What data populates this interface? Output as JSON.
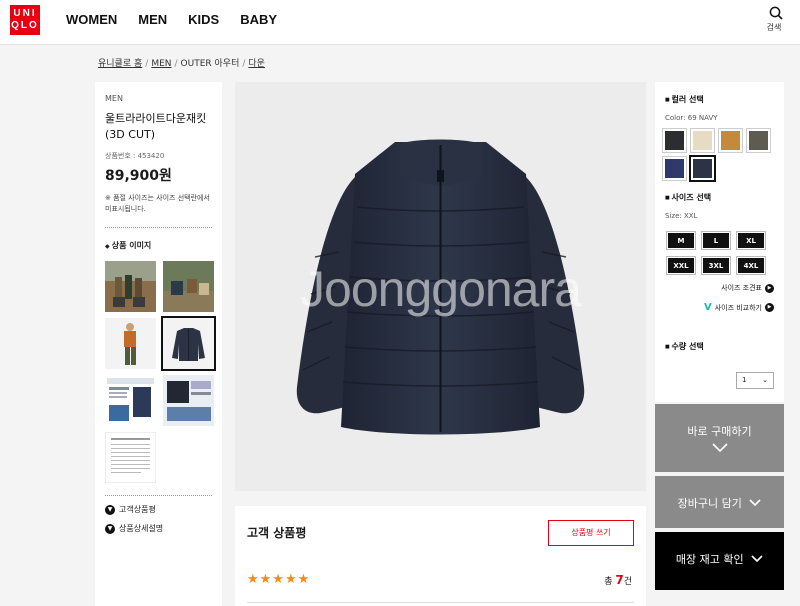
{
  "header": {
    "logo_line1": "UNI",
    "logo_line2": "QLO",
    "nav": [
      "WOMEN",
      "MEN",
      "KIDS",
      "BABY"
    ],
    "search_label": "검색"
  },
  "breadcrumb": {
    "home": "유니클로 홈",
    "men": "MEN",
    "outer": "OUTER 아우터",
    "current": "다운"
  },
  "product": {
    "category": "MEN",
    "name": "울트라라이트다운재킷(3D CUT)",
    "number": "상품번호 : 453420",
    "price": "89,900원",
    "size_note": "※ 품절 사이즈는 사이즈 선택란에서 미표시됩니다."
  },
  "images": {
    "section_title": "상품 이미지",
    "thumbs": [
      "thumb-outdoor-group",
      "thumb-outdoor-sitting",
      "thumb-model-orange",
      "thumb-jacket-navy",
      "thumb-feature-info",
      "thumb-feature-detail",
      "thumb-size-chart"
    ]
  },
  "left_menu": {
    "similar": "고객상품평",
    "detail": "상품상세설명"
  },
  "main_image": {
    "watermark": "Joonggonara"
  },
  "review": {
    "title": "고객 상품평",
    "write_button": "상품평 쓰기",
    "stars": "★★★★★",
    "count_prefix": "총",
    "count": "7",
    "count_suffix": "건"
  },
  "options": {
    "color_title": "컬러 선택",
    "color_selected": "Color: 69 NAVY",
    "colors": [
      "#2b2d30",
      "#e6dbc3",
      "#c5893c",
      "#5e5c51",
      "#2e3a6b",
      "#2c3345"
    ],
    "size_title": "사이즈 선택",
    "size_selected": "Size: XXL",
    "sizes": [
      "M",
      "L",
      "XL",
      "XXL",
      "3XL",
      "4XL"
    ],
    "size_chart_link": "사이즈 조견표",
    "size_compare_link": "사이즈 비교하기",
    "qty_title": "수량 선택",
    "qty_value": "1"
  },
  "buttons": {
    "buy": "바로 구매하기",
    "cart": "장바구니 담기",
    "store": "매장 재고 확인"
  }
}
